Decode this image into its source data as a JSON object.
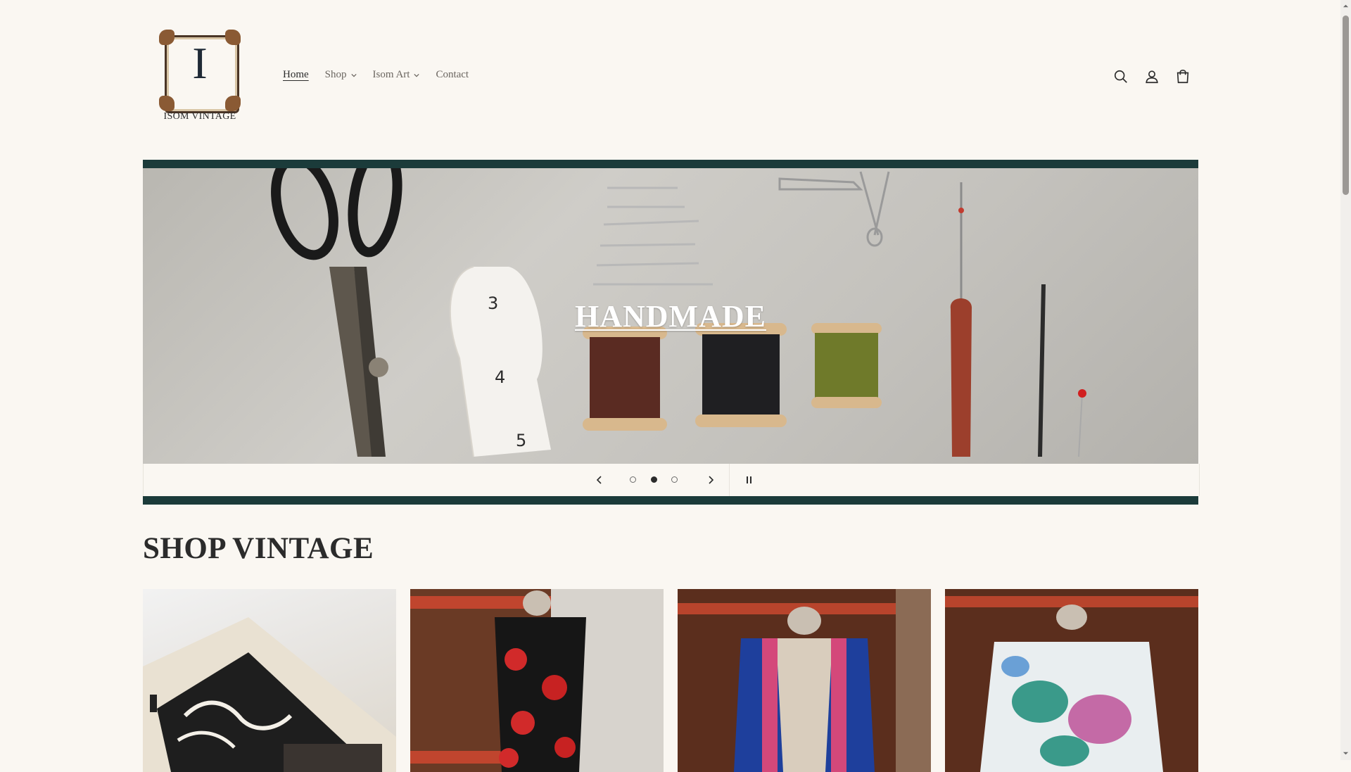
{
  "brand": {
    "logo_letter": "I",
    "logo_text": "ISOM VINTAGE"
  },
  "nav": {
    "items": [
      {
        "label": "Home",
        "active": true,
        "has_dropdown": false
      },
      {
        "label": "Shop",
        "active": false,
        "has_dropdown": true
      },
      {
        "label": "Isom Art",
        "active": false,
        "has_dropdown": true
      },
      {
        "label": "Contact",
        "active": false,
        "has_dropdown": false
      }
    ]
  },
  "header_icons": [
    "search-icon",
    "account-icon",
    "cart-icon"
  ],
  "slideshow": {
    "heading": "HANDMADE",
    "slide_count": 3,
    "active_slide": 2,
    "accent_color": "#1b3b3a"
  },
  "section": {
    "title": "SHOP VINTAGE"
  },
  "products": [
    {
      "name": "scarf"
    },
    {
      "name": "floral-jacket"
    },
    {
      "name": "blue-striped-jacket"
    },
    {
      "name": "floral-blouse"
    }
  ],
  "colors": {
    "background": "#faf7f2",
    "text": "#2b2b2b",
    "muted": "#6b6660"
  }
}
